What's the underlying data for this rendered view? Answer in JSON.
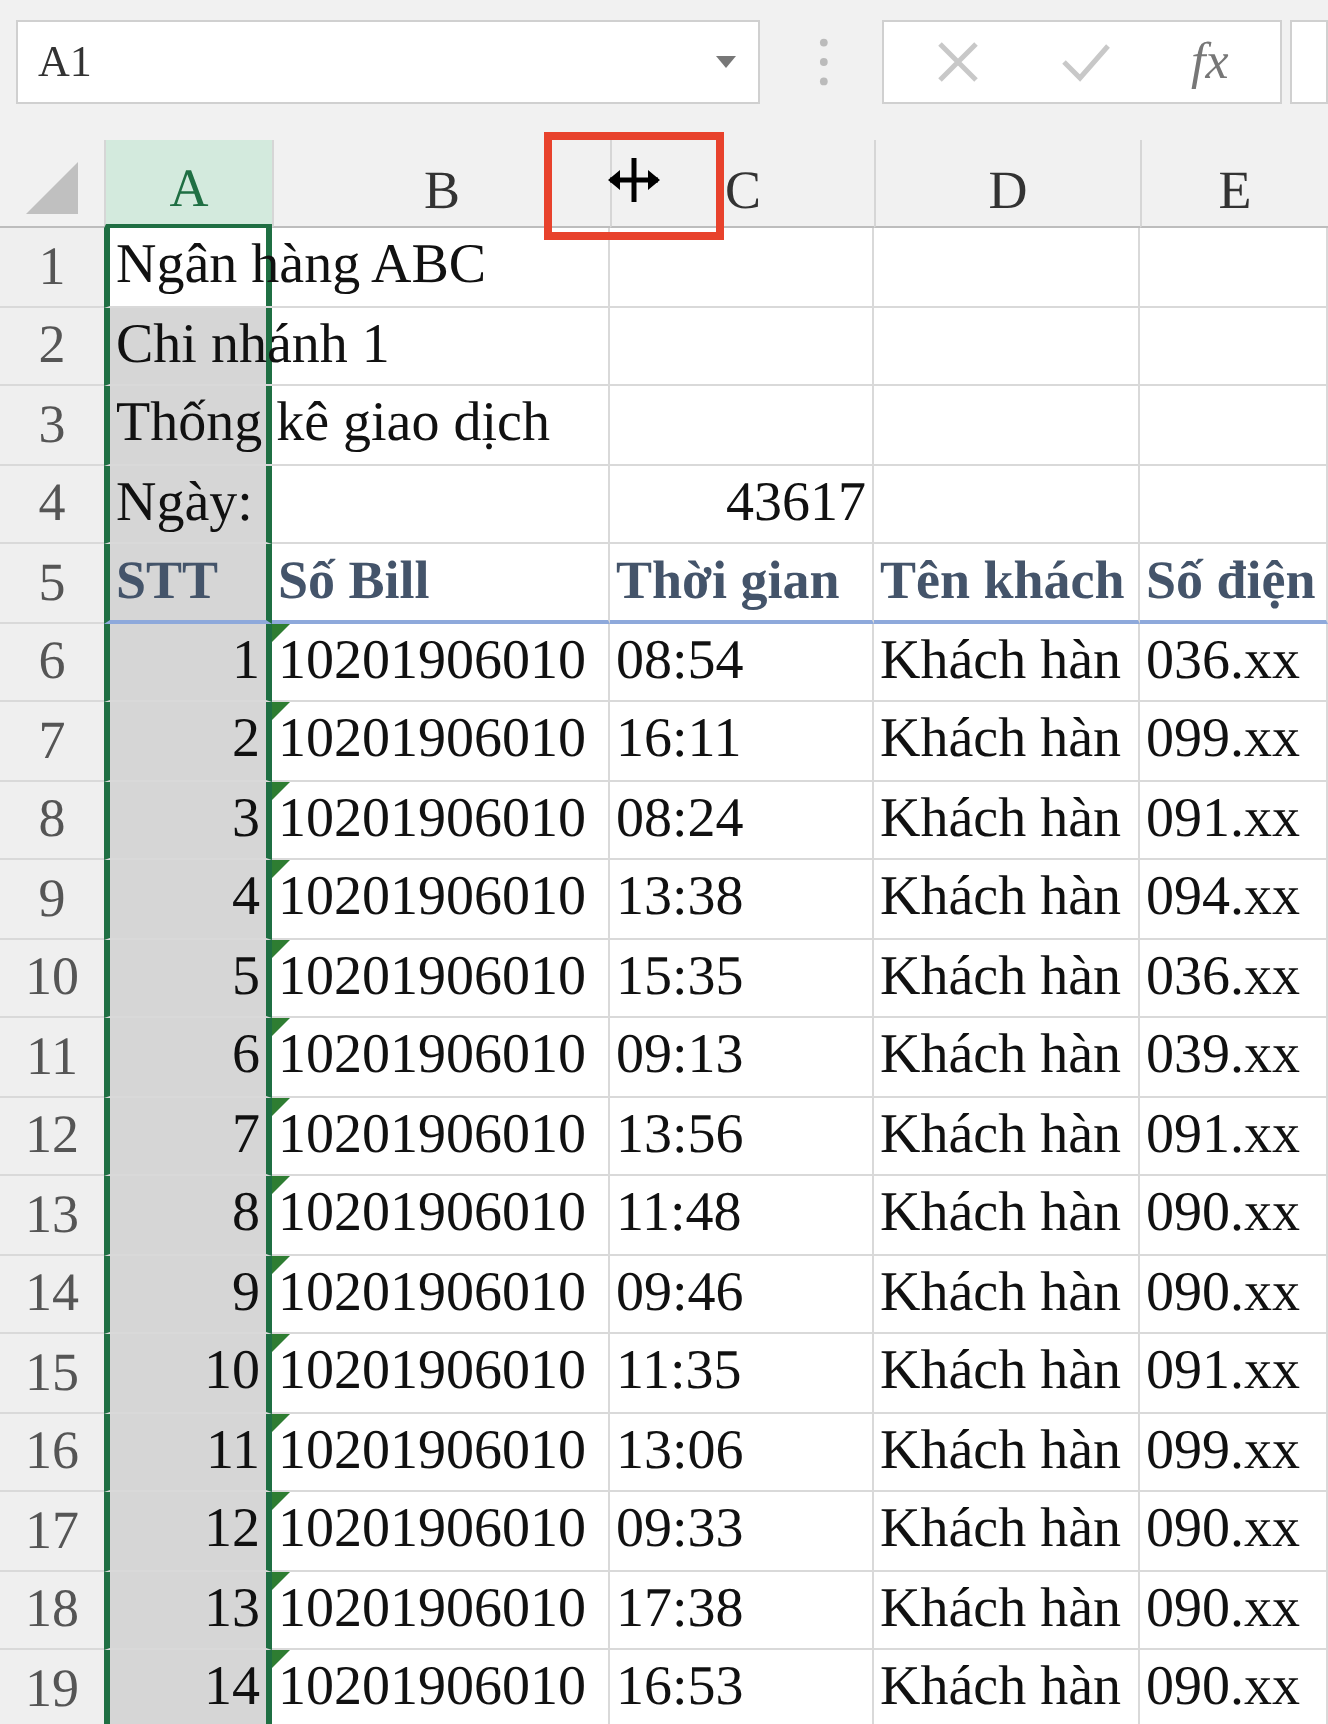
{
  "name_box": {
    "value": "A1"
  },
  "formula_bar": {
    "function_label": "fx"
  },
  "columns": [
    {
      "label": "A",
      "selected": true
    },
    {
      "label": "B",
      "selected": false
    },
    {
      "label": "C",
      "selected": false
    },
    {
      "label": "D",
      "selected": false
    },
    {
      "label": "E",
      "selected": false
    }
  ],
  "rows": [
    {
      "number": "1",
      "kind": "title",
      "active": true,
      "a": "Ngân hàng ABC"
    },
    {
      "number": "2",
      "kind": "title",
      "active": false,
      "a": "Chi nhánh 1"
    },
    {
      "number": "3",
      "kind": "title",
      "active": false,
      "a": "Thống kê giao dịch"
    },
    {
      "number": "4",
      "kind": "date",
      "active": false,
      "a": "Ngày:",
      "c": "43617"
    },
    {
      "number": "5",
      "kind": "header",
      "active": false,
      "a": "STT",
      "b": "Số Bill",
      "c": "Thời gian",
      "d": "Tên khách",
      "e": "Số điện"
    },
    {
      "number": "6",
      "kind": "data",
      "active": false,
      "a": "1",
      "b": "10201906010",
      "c": "08:54",
      "d": "Khách hàn",
      "e": "036.xx"
    },
    {
      "number": "7",
      "kind": "data",
      "active": false,
      "a": "2",
      "b": "10201906010",
      "c": "16:11",
      "d": "Khách hàn",
      "e": "099.xx"
    },
    {
      "number": "8",
      "kind": "data",
      "active": false,
      "a": "3",
      "b": "10201906010",
      "c": "08:24",
      "d": "Khách hàn",
      "e": "091.xx"
    },
    {
      "number": "9",
      "kind": "data",
      "active": false,
      "a": "4",
      "b": "10201906010",
      "c": "13:38",
      "d": "Khách hàn",
      "e": "094.xx"
    },
    {
      "number": "10",
      "kind": "data",
      "active": false,
      "a": "5",
      "b": "10201906010",
      "c": "15:35",
      "d": "Khách hàn",
      "e": "036.xx"
    },
    {
      "number": "11",
      "kind": "data",
      "active": false,
      "a": "6",
      "b": "10201906010",
      "c": "09:13",
      "d": "Khách hàn",
      "e": "039.xx"
    },
    {
      "number": "12",
      "kind": "data",
      "active": false,
      "a": "7",
      "b": "10201906010",
      "c": "13:56",
      "d": "Khách hàn",
      "e": "091.xx"
    },
    {
      "number": "13",
      "kind": "data",
      "active": false,
      "a": "8",
      "b": "10201906010",
      "c": "11:48",
      "d": "Khách hàn",
      "e": "090.xx"
    },
    {
      "number": "14",
      "kind": "data",
      "active": false,
      "a": "9",
      "b": "10201906010",
      "c": "09:46",
      "d": "Khách hàn",
      "e": "090.xx"
    },
    {
      "number": "15",
      "kind": "data",
      "active": false,
      "a": "10",
      "b": "10201906010",
      "c": "11:35",
      "d": "Khách hàn",
      "e": "091.xx"
    },
    {
      "number": "16",
      "kind": "data",
      "active": false,
      "a": "11",
      "b": "10201906010",
      "c": "13:06",
      "d": "Khách hàn",
      "e": "099.xx"
    },
    {
      "number": "17",
      "kind": "data",
      "active": false,
      "a": "12",
      "b": "10201906010",
      "c": "09:33",
      "d": "Khách hàn",
      "e": "090.xx"
    },
    {
      "number": "18",
      "kind": "data",
      "active": false,
      "a": "13",
      "b": "10201906010",
      "c": "17:38",
      "d": "Khách hàn",
      "e": "090.xx"
    },
    {
      "number": "19",
      "kind": "data",
      "active": false,
      "a": "14",
      "b": "10201906010",
      "c": "16:53",
      "d": "Khách hàn",
      "e": "090.xx"
    }
  ]
}
